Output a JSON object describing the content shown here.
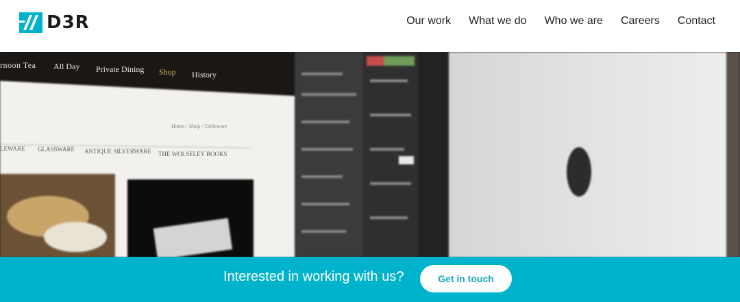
{
  "brand": {
    "name": "D3R",
    "accent": "#00b3cc"
  },
  "nav": {
    "items": [
      "Our work",
      "What we do",
      "Who we are",
      "Careers",
      "Contact"
    ]
  },
  "hero": {
    "site_nav": [
      "rnoon Tea",
      "All Day",
      "Private Dining",
      "Shop",
      "History"
    ],
    "breadcrumb": "Home / Shop / Tableware",
    "categories": [
      "LEWARE",
      "GLASSWARE",
      "ANTIQUE SILVERWARE",
      "THE WOLSELEY BOOKS"
    ]
  },
  "cta": {
    "text": "Interested in working with us?",
    "button_label": "Get in touch"
  }
}
